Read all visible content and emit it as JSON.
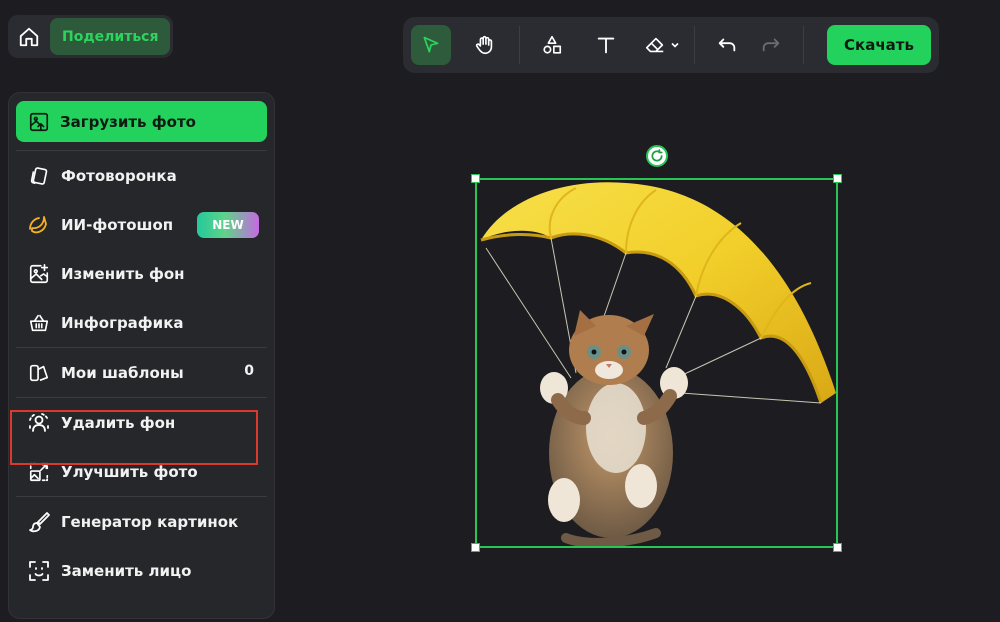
{
  "topbar": {
    "share_label": "Поделиться"
  },
  "toolbar": {
    "download_label": "Скачать",
    "tools": [
      "select-tool",
      "hand-tool",
      "shapes-tool",
      "text-tool",
      "eraser-tool",
      "undo",
      "redo"
    ]
  },
  "sidebar": {
    "upload_label": "Загрузить фото",
    "items": [
      {
        "label": "Фотоворонка",
        "icon": "cards-icon"
      },
      {
        "label": "ИИ-фотошоп",
        "icon": "banana-icon",
        "badge": "NEW"
      },
      {
        "label": "Изменить фон",
        "icon": "image-plus-icon"
      },
      {
        "label": "Инфографика",
        "icon": "basket-icon"
      },
      {
        "label": "Мои шаблоны",
        "icon": "templates-icon",
        "count": "0"
      },
      {
        "label": "Удалить фон",
        "icon": "remove-bg-icon"
      },
      {
        "label": "Улучшить фото",
        "icon": "enhance-icon"
      },
      {
        "label": "Генератор картинок",
        "icon": "brush-icon"
      },
      {
        "label": "Заменить лицо",
        "icon": "face-swap-icon"
      }
    ]
  },
  "colors": {
    "accent": "#22d25c",
    "background": "#1d1d21",
    "panel": "#26272b",
    "highlight": "#d93a2c"
  }
}
